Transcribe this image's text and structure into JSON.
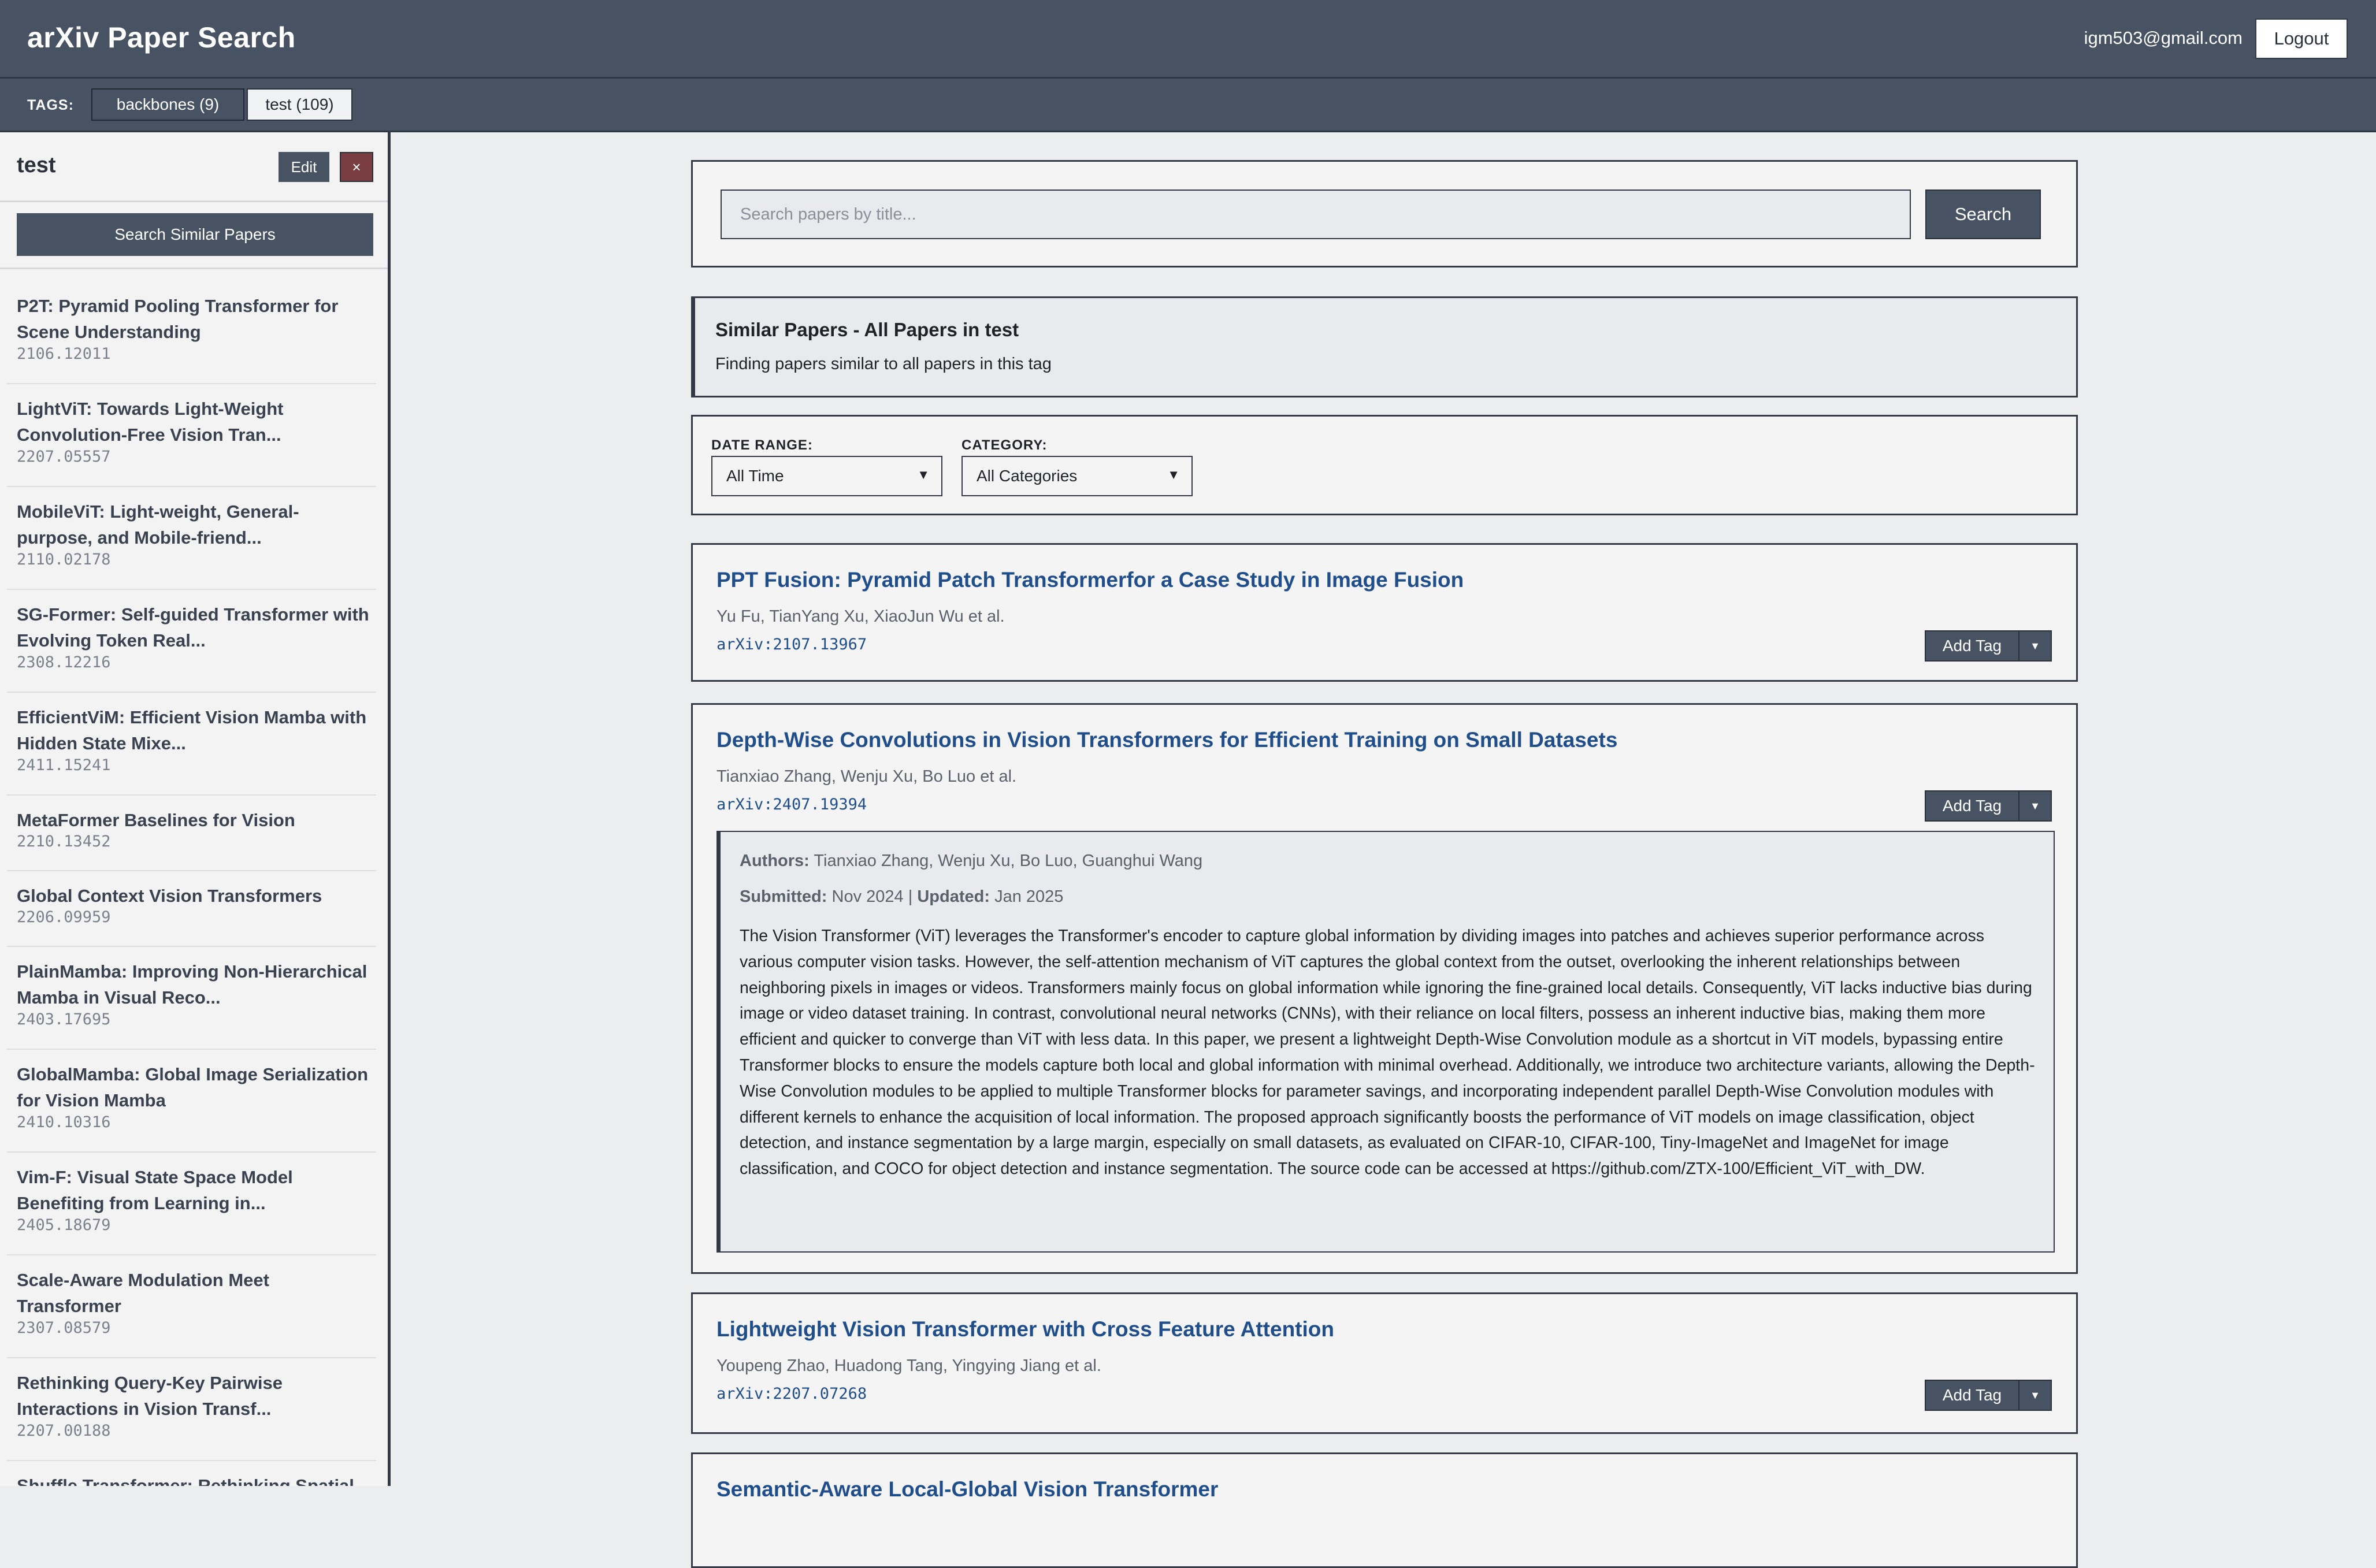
{
  "header": {
    "app_title": "arXiv Paper Search",
    "user_email": "igm503@gmail.com",
    "logout_label": "Logout"
  },
  "tags_bar": {
    "label": "TAGS:",
    "tags": [
      {
        "label": "backbones (9)",
        "active": true
      },
      {
        "label": "test (109)",
        "active": false
      }
    ]
  },
  "sidebar": {
    "tag_name": "test",
    "edit_label": "Edit",
    "delete_label": "×",
    "search_similar_label": "Search Similar Papers",
    "papers": [
      {
        "title": "P2T: Pyramid Pooling Transformer for Scene Understanding",
        "id": "2106.12011"
      },
      {
        "title": "LightViT: Towards Light-Weight Convolution-Free Vision Tran...",
        "id": "2207.05557"
      },
      {
        "title": "MobileViT: Light-weight, General-purpose, and Mobile-friend...",
        "id": "2110.02178"
      },
      {
        "title": "SG-Former: Self-guided Transformer with Evolving Token Real...",
        "id": "2308.12216"
      },
      {
        "title": "EfficientViM: Efficient Vision Mamba with Hidden State Mixe...",
        "id": "2411.15241"
      },
      {
        "title": "MetaFormer Baselines for Vision",
        "id": "2210.13452"
      },
      {
        "title": "Global Context Vision Transformers",
        "id": "2206.09959"
      },
      {
        "title": "PlainMamba: Improving Non-Hierarchical Mamba in Visual Reco...",
        "id": "2403.17695"
      },
      {
        "title": "GlobalMamba: Global Image Serialization for Vision Mamba",
        "id": "2410.10316"
      },
      {
        "title": "Vim-F: Visual State Space Model Benefiting from Learning in...",
        "id": "2405.18679"
      },
      {
        "title": "Scale-Aware Modulation Meet Transformer",
        "id": "2307.08579"
      },
      {
        "title": "Rethinking Query-Key Pairwise Interactions in Vision Transf...",
        "id": "2207.00188"
      },
      {
        "title": "Shuffle Transformer: Rethinking Spatial",
        "id": ""
      }
    ]
  },
  "search": {
    "placeholder": "Search papers by title...",
    "button_label": "Search"
  },
  "similar_info": {
    "title": "Similar Papers - All Papers in test",
    "subtitle": "Finding papers similar to all papers in this tag"
  },
  "filters": {
    "date_label": "DATE RANGE:",
    "date_value": "All Time",
    "category_label": "CATEGORY:",
    "category_value": "All Categories"
  },
  "add_tag_label": "Add Tag",
  "caret": "▼",
  "papers": [
    {
      "title": "PPT Fusion: Pyramid Patch Transformerfor a Case Study in Image Fusion",
      "authors": "Yu Fu, TianYang Xu, XiaoJun Wu et al.",
      "arxiv": "arXiv:2107.13967"
    },
    {
      "title": "Depth-Wise Convolutions in Vision Transformers for Efficient Training on Small Datasets",
      "authors": "Tianxiao Zhang, Wenju Xu, Bo Luo et al.",
      "arxiv": "arXiv:2407.19394",
      "details": {
        "authors_label": "Authors:",
        "authors_full": "Tianxiao Zhang, Wenju Xu, Bo Luo, Guanghui Wang",
        "submitted_label": "Submitted:",
        "submitted": "Nov 2024",
        "sep": "|",
        "updated_label": "Updated:",
        "updated": "Jan 2025",
        "abstract": "The Vision Transformer (ViT) leverages the Transformer's encoder to capture global information by dividing images into patches and achieves superior performance across various computer vision tasks. However, the self-attention mechanism of ViT captures the global context from the outset, overlooking the inherent relationships between neighboring pixels in images or videos. Transformers mainly focus on global information while ignoring the fine-grained local details. Consequently, ViT lacks inductive bias during image or video dataset training. In contrast, convolutional neural networks (CNNs), with their reliance on local filters, possess an inherent inductive bias, making them more efficient and quicker to converge than ViT with less data. In this paper, we present a lightweight Depth-Wise Convolution module as a shortcut in ViT models, bypassing entire Transformer blocks to ensure the models capture both local and global information with minimal overhead. Additionally, we introduce two architecture variants, allowing the Depth-Wise Convolution modules to be applied to multiple Transformer blocks for parameter savings, and incorporating independent parallel Depth-Wise Convolution modules with different kernels to enhance the acquisition of local information. The proposed approach significantly boosts the performance of ViT models on image classification, object detection, and instance segmentation by a large margin, especially on small datasets, as evaluated on CIFAR-10, CIFAR-100, Tiny-ImageNet and ImageNet for image classification, and COCO for object detection and instance segmentation. The source code can be accessed at https://github.com/ZTX-100/Efficient_ViT_with_DW."
      }
    },
    {
      "title": "Lightweight Vision Transformer with Cross Feature Attention",
      "authors": "Youpeng Zhao, Huadong Tang, Yingying Jiang et al.",
      "arxiv": "arXiv:2207.07268"
    },
    {
      "title": "Semantic-Aware Local-Global Vision Transformer",
      "authors": "",
      "arxiv": ""
    }
  ]
}
